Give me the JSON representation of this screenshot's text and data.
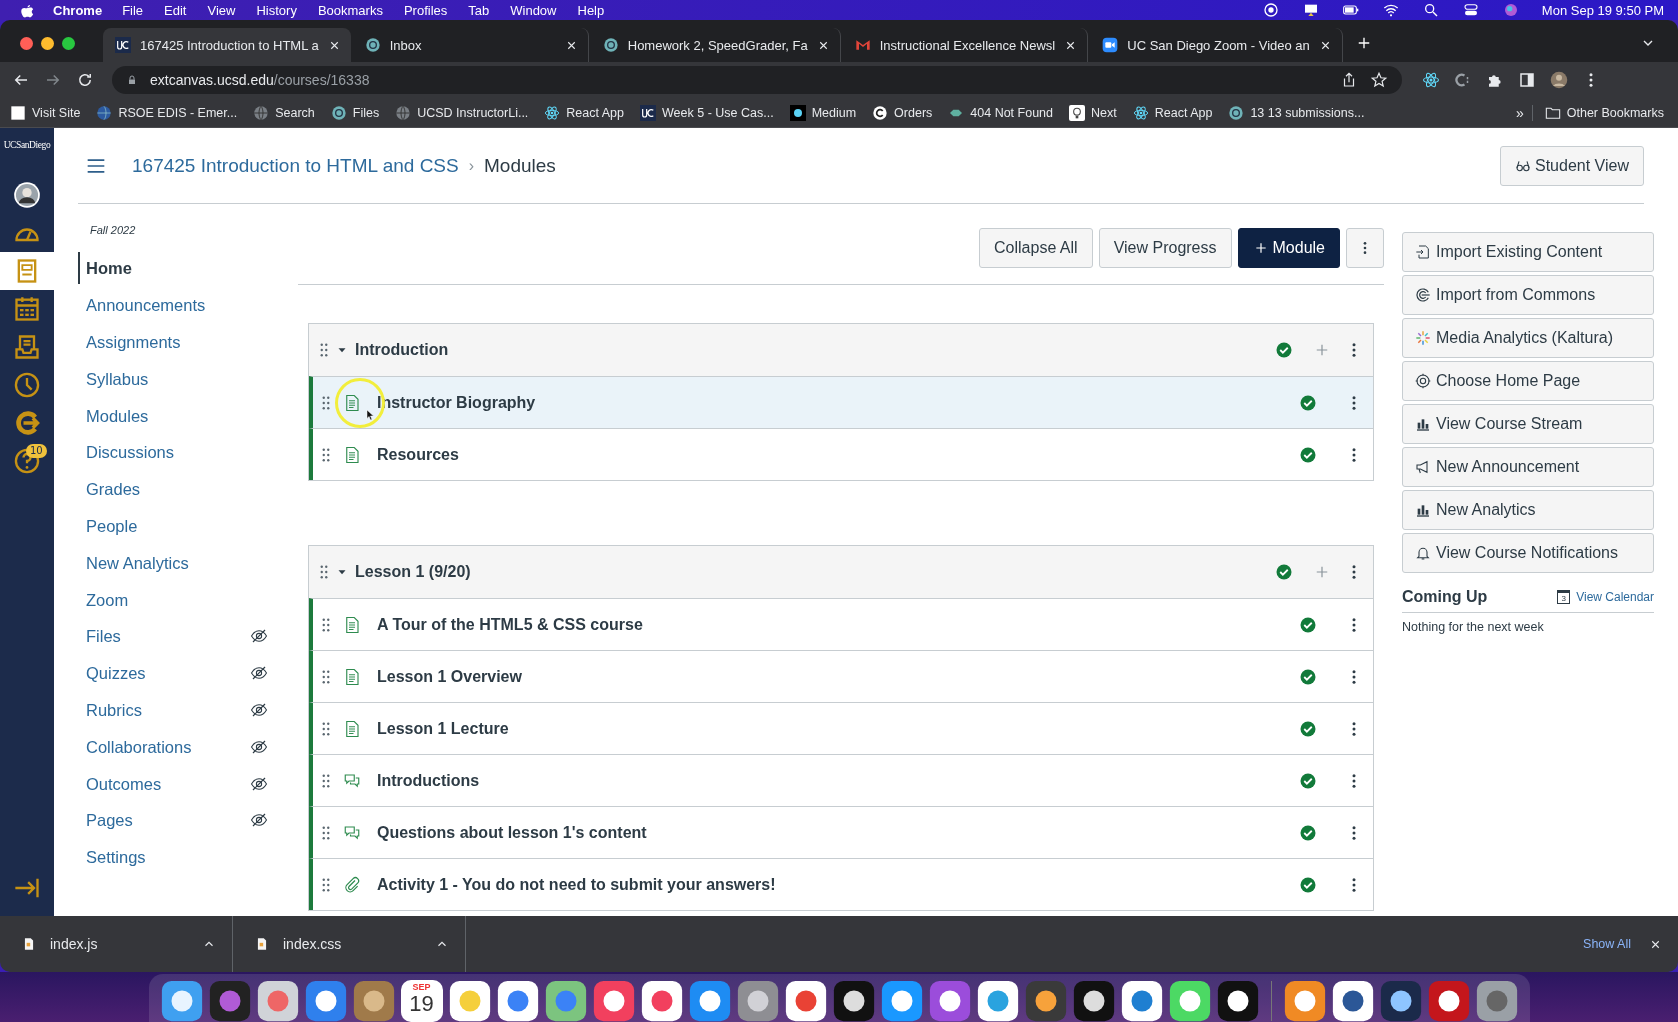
{
  "menu_bar": {
    "app": "Chrome",
    "menus": [
      "File",
      "Edit",
      "View",
      "History",
      "Bookmarks",
      "Profiles",
      "Tab",
      "Window",
      "Help"
    ],
    "status_icons": [
      {
        "kind": "record"
      },
      {
        "kind": "display"
      },
      {
        "kind": "battery"
      },
      {
        "kind": "wifi"
      },
      {
        "kind": "search"
      },
      {
        "kind": "control"
      },
      {
        "kind": "siri"
      }
    ],
    "clock": "Mon Sep 19  9:50 PM"
  },
  "tabs": [
    {
      "kind": "uc",
      "title": "167425 Introduction to HTML a",
      "selected": true
    },
    {
      "kind": "canvas",
      "title": "Inbox",
      "selected": false
    },
    {
      "kind": "canvas",
      "title": "Homework 2, SpeedGrader, Fa",
      "selected": false
    },
    {
      "kind": "gmail",
      "title": "Instructional Excellence Newsl",
      "selected": false
    },
    {
      "kind": "zoom",
      "title": "UC San Diego Zoom - Video an",
      "selected": false
    }
  ],
  "address_bar": {
    "host": "extcanvas.ucsd.edu",
    "path": "/courses/16338"
  },
  "bookmarks": [
    {
      "kind": "page",
      "label": "Visit Site"
    },
    {
      "kind": "rsoe",
      "label": "RSOE EDIS - Emer..."
    },
    {
      "kind": "globe",
      "label": "Search"
    },
    {
      "kind": "canvas",
      "label": "Files"
    },
    {
      "kind": "globe",
      "label": "UCSD InstructorLi..."
    },
    {
      "kind": "react",
      "label": "React App"
    },
    {
      "kind": "uc",
      "label": "Week 5 - Use Cas..."
    },
    {
      "kind": "medium",
      "label": "Medium"
    },
    {
      "kind": "orders",
      "label": "Orders"
    },
    {
      "kind": "fish",
      "label": "404 Not Found"
    },
    {
      "kind": "bulb",
      "label": "Next"
    },
    {
      "kind": "react",
      "label": "React App"
    },
    {
      "kind": "canvas",
      "label": "13 13 submissions..."
    }
  ],
  "bookmarks_more": "»",
  "other_bookmarks": "Other Bookmarks",
  "global_nav": {
    "logo": "UCSanDiego",
    "items": [
      {
        "kind": "avatar",
        "selected": false
      },
      {
        "kind": "dashboard",
        "selected": false
      },
      {
        "kind": "courses",
        "selected": true
      },
      {
        "kind": "calendar",
        "selected": false
      },
      {
        "kind": "inbox",
        "selected": false
      },
      {
        "kind": "history",
        "selected": false
      },
      {
        "kind": "commons",
        "selected": false
      },
      {
        "kind": "help",
        "selected": false,
        "badge": "10"
      }
    ]
  },
  "breadcrumb": {
    "course": "167425 Introduction to HTML and CSS",
    "separator": "›",
    "page": "Modules"
  },
  "student_view": "Student View",
  "term": "Fall 2022",
  "course_nav": [
    {
      "label": "Home",
      "selected": true,
      "hidden": false
    },
    {
      "label": "Announcements",
      "selected": false,
      "hidden": false
    },
    {
      "label": "Assignments",
      "selected": false,
      "hidden": false
    },
    {
      "label": "Syllabus",
      "selected": false,
      "hidden": false
    },
    {
      "label": "Modules",
      "selected": false,
      "hidden": false
    },
    {
      "label": "Discussions",
      "selected": false,
      "hidden": false
    },
    {
      "label": "Grades",
      "selected": false,
      "hidden": false
    },
    {
      "label": "People",
      "selected": false,
      "hidden": false
    },
    {
      "label": "New Analytics",
      "selected": false,
      "hidden": false
    },
    {
      "label": "Zoom",
      "selected": false,
      "hidden": false
    },
    {
      "label": "Files",
      "selected": false,
      "hidden": true
    },
    {
      "label": "Quizzes",
      "selected": false,
      "hidden": true
    },
    {
      "label": "Rubrics",
      "selected": false,
      "hidden": true
    },
    {
      "label": "Collaborations",
      "selected": false,
      "hidden": true
    },
    {
      "label": "Outcomes",
      "selected": false,
      "hidden": true
    },
    {
      "label": "Pages",
      "selected": false,
      "hidden": true
    },
    {
      "label": "Settings",
      "selected": false,
      "hidden": false
    }
  ],
  "toolbar": [
    {
      "kind": "plain",
      "label": "Collapse All"
    },
    {
      "kind": "plain",
      "label": "View Progress"
    },
    {
      "kind": "primary",
      "label": "Module"
    },
    {
      "kind": "more"
    }
  ],
  "modules": [
    {
      "title": "Introduction",
      "expanded": true,
      "published": true,
      "items": [
        {
          "kind": "page",
          "title": "Instructor Biography",
          "published": true,
          "selected": true,
          "pointer": true
        },
        {
          "kind": "page",
          "title": "Resources",
          "published": true,
          "selected": false,
          "pointer": false
        }
      ]
    },
    {
      "title": "Lesson 1 (9/20)",
      "expanded": true,
      "published": true,
      "items": [
        {
          "kind": "page",
          "title": "A Tour of the HTML5 & CSS course",
          "published": true,
          "selected": false,
          "pointer": false
        },
        {
          "kind": "page",
          "title": "Lesson 1 Overview",
          "published": true,
          "selected": false,
          "pointer": false
        },
        {
          "kind": "page",
          "title": "Lesson 1 Lecture",
          "published": true,
          "selected": false,
          "pointer": false
        },
        {
          "kind": "discussion",
          "title": "Introductions",
          "published": true,
          "selected": false,
          "pointer": false
        },
        {
          "kind": "discussion",
          "title": "Questions about lesson 1's content",
          "published": true,
          "selected": false,
          "pointer": false
        },
        {
          "kind": "assignment",
          "title": "Activity 1 - You do not need to submit your answers!",
          "published": true,
          "selected": false,
          "pointer": false
        }
      ]
    }
  ],
  "sidebar_buttons": [
    {
      "kind": "import",
      "label": "Import Existing Content"
    },
    {
      "kind": "commons",
      "label": "Import from Commons"
    },
    {
      "kind": "kaltura",
      "label": "Media Analytics (Kaltura)"
    },
    {
      "kind": "target",
      "label": "Choose Home Page"
    },
    {
      "kind": "bars",
      "label": "View Course Stream"
    },
    {
      "kind": "megaphone",
      "label": "New Announcement"
    },
    {
      "kind": "bars",
      "label": "New Analytics"
    },
    {
      "kind": "bell",
      "label": "View Course Notifications"
    }
  ],
  "coming_up": {
    "title": "Coming Up",
    "link": "View Calendar",
    "calendar_day": "3",
    "empty": "Nothing for the next week"
  },
  "downloads": {
    "files": [
      {
        "name": "index.js"
      },
      {
        "name": "index.css"
      }
    ],
    "show_all": "Show All"
  },
  "dock": [
    {
      "kind": "finder"
    },
    {
      "kind": "siri"
    },
    {
      "kind": "launchpad"
    },
    {
      "kind": "mail"
    },
    {
      "kind": "contacts"
    },
    {
      "kind": "calendar",
      "month": "SEP",
      "day": "19"
    },
    {
      "kind": "notes"
    },
    {
      "kind": "reminders"
    },
    {
      "kind": "maps"
    },
    {
      "kind": "music"
    },
    {
      "kind": "news"
    },
    {
      "kind": "appstore"
    },
    {
      "kind": "settings"
    },
    {
      "kind": "chrome"
    },
    {
      "kind": "crypto"
    },
    {
      "kind": "prime"
    },
    {
      "kind": "podcasts"
    },
    {
      "kind": "telegram"
    },
    {
      "kind": "sublime"
    },
    {
      "kind": "terminal"
    },
    {
      "kind": "vscode"
    },
    {
      "kind": "messages"
    },
    {
      "kind": "tv"
    },
    {
      "kind": "books"
    },
    {
      "kind": "word"
    },
    {
      "kind": "recorder"
    },
    {
      "kind": "acrobat"
    },
    {
      "kind": "trash"
    }
  ]
}
